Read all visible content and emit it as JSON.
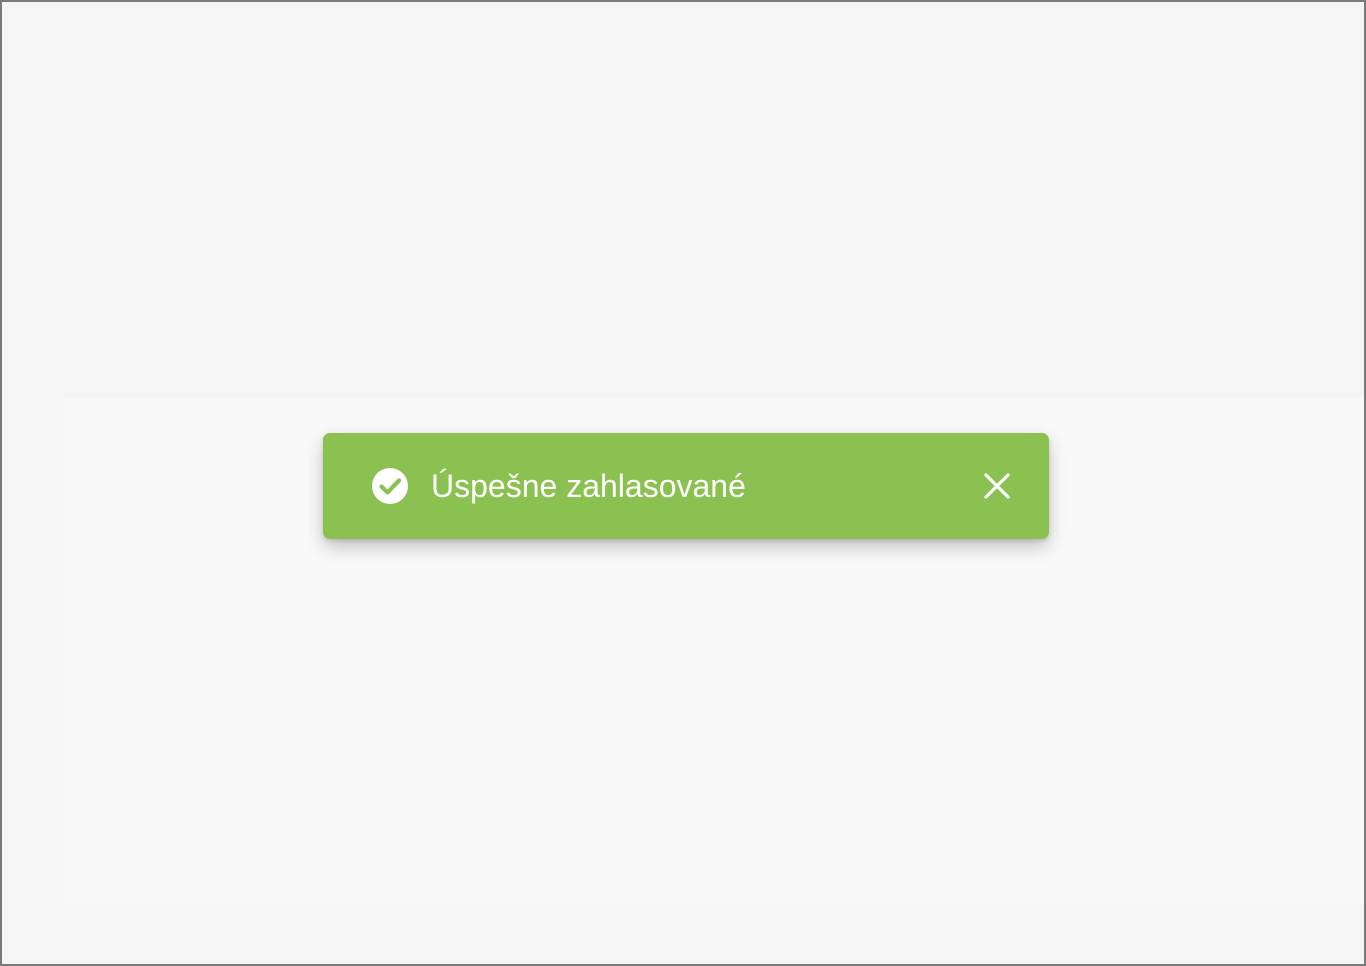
{
  "toast": {
    "status": "success",
    "message": "Úspešne zahlasované",
    "icon": "check-circle-icon",
    "close_icon": "close-icon",
    "background_color": "#8bc151",
    "text_color": "#ffffff"
  }
}
